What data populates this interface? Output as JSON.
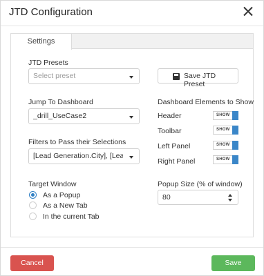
{
  "dialog": {
    "title": "JTD Configuration"
  },
  "tabs": [
    {
      "label": "Settings"
    }
  ],
  "presets": {
    "label": "JTD Presets",
    "placeholder": "Select preset",
    "save_label": "Save JTD Preset"
  },
  "dashboard": {
    "label": "Jump To Dashboard",
    "value": "_drill_UseCase2"
  },
  "filters": {
    "label": "Filters to Pass their Selections",
    "value": "[Lead Generation.City], [Lead ..."
  },
  "elements": {
    "label": "Dashboard Elements to Show",
    "items": [
      {
        "label": "Header",
        "toggle": "SHOW",
        "on": true
      },
      {
        "label": "Toolbar",
        "toggle": "SHOW",
        "on": true
      },
      {
        "label": "Left Panel",
        "toggle": "SHOW",
        "on": true
      },
      {
        "label": "Right Panel",
        "toggle": "SHOW",
        "on": true
      }
    ]
  },
  "target": {
    "label": "Target Window",
    "options": [
      {
        "label": "As a Popup",
        "checked": true
      },
      {
        "label": "As a New Tab",
        "checked": false
      },
      {
        "label": "In the current Tab",
        "checked": false
      }
    ]
  },
  "popup_size": {
    "label": "Popup Size (% of window)",
    "value": "80"
  },
  "footer": {
    "cancel_label": "Cancel",
    "save_label": "Save"
  },
  "colors": {
    "cancel": "#d9534f",
    "save": "#5cb85c",
    "accent": "#3a86c8"
  }
}
